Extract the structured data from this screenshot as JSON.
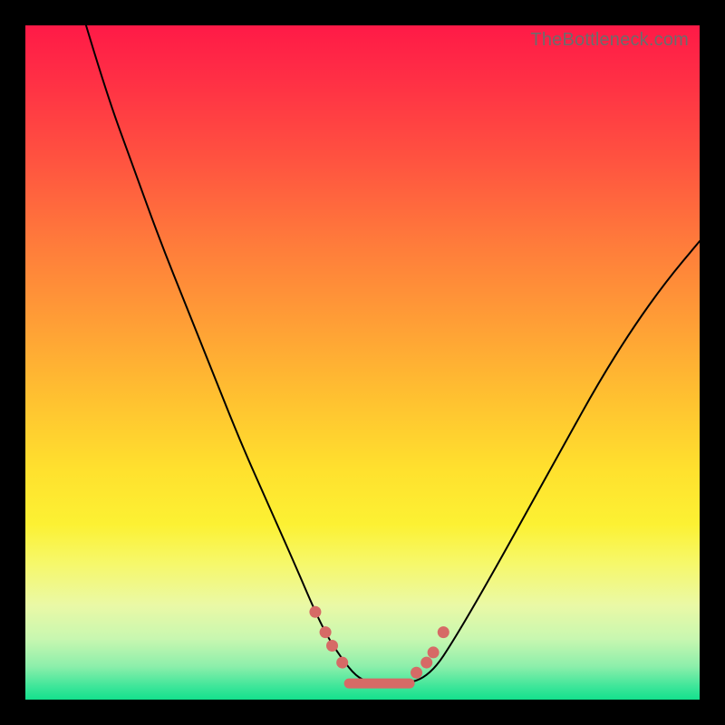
{
  "watermark": "TheBottleneck.com",
  "colors": {
    "background": "#000000",
    "gradient_top": "#ff1a47",
    "gradient_mid": "#ffe12e",
    "gradient_bottom": "#14e08d",
    "curve": "#000000",
    "markers": "#d66a66"
  },
  "chart_data": {
    "type": "line",
    "title": "",
    "xlabel": "",
    "ylabel": "",
    "xlim": [
      0,
      100
    ],
    "ylim": [
      0,
      100
    ],
    "series": [
      {
        "name": "bottleneck-curve",
        "x": [
          9,
          12,
          16,
          20,
          24,
          28,
          32,
          36,
          40,
          43,
          45,
          47,
          49,
          51,
          53,
          55,
          57,
          59,
          61,
          63,
          66,
          70,
          75,
          80,
          85,
          90,
          95,
          100
        ],
        "y": [
          100,
          90,
          79,
          68,
          58,
          48,
          38,
          29,
          20,
          13,
          9,
          6,
          3.5,
          2.5,
          2.3,
          2.3,
          2.5,
          3.2,
          5,
          8,
          13,
          20,
          29,
          38,
          47,
          55,
          62,
          68
        ]
      }
    ],
    "markers": {
      "name": "highlight-points",
      "x": [
        43.0,
        44.5,
        45.5,
        47.0,
        58.0,
        59.5,
        60.5,
        62.0
      ],
      "y": [
        13.0,
        10.0,
        8.0,
        5.5,
        4.0,
        5.5,
        7.0,
        10.0
      ]
    },
    "flat_highlight": {
      "x_start": 48,
      "x_end": 57,
      "y": 2.4
    },
    "notes": "Axes have no visible tick labels; x and y are normalized 0–100 across the plot area. y measures distance from the bottom (0 = bottom green edge, 100 = top red edge)."
  }
}
